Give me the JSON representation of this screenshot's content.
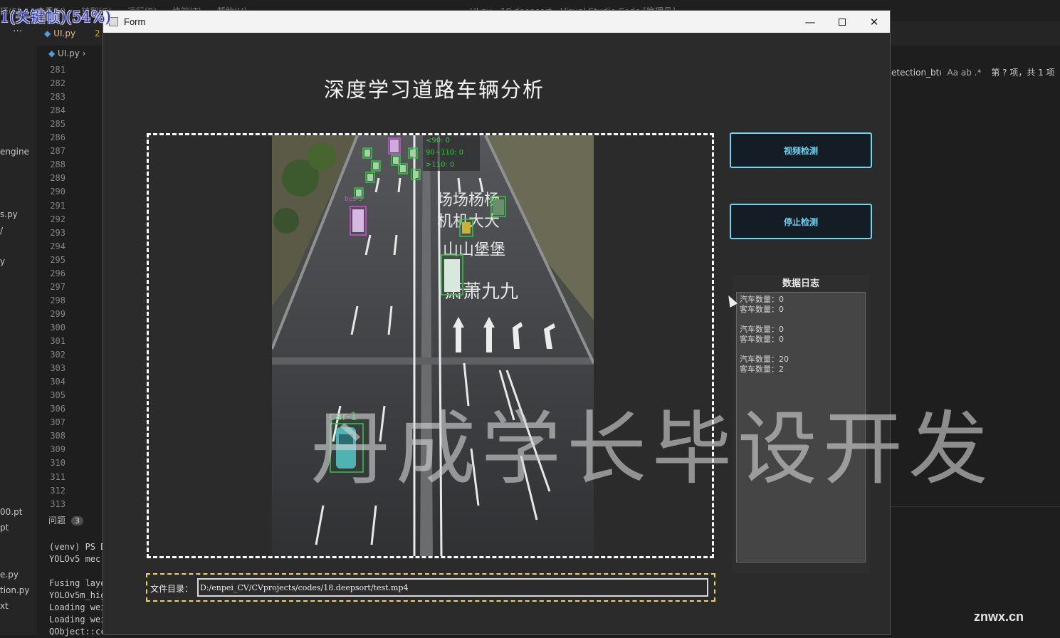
{
  "vscode": {
    "overlay_status": "1(关键帧)(54%)",
    "menus": [
      "择(S)",
      "查看(V)",
      "转到(G)",
      "运行(R)",
      "终端(T)",
      "帮助(H)"
    ],
    "window_title": "UI.py - 18.deepsort - Visual Studio Code [管理员]",
    "ellipsis": "···",
    "tab_file": "UI.py",
    "tab_num": "2",
    "breadcrumb": "UI.py",
    "explorer_items": [
      "engine",
      "s.py",
      "/",
      "y",
      "00.pt",
      "pt",
      "e.py",
      "tion.py",
      "xt"
    ],
    "line_numbers": [
      "281",
      "282",
      "283",
      "284",
      "285",
      "286",
      "287",
      "288",
      "289",
      "290",
      "291",
      "292",
      "293",
      "294",
      "295",
      "296",
      "297",
      "298",
      "299",
      "300",
      "301",
      "302",
      "303",
      "304",
      "305",
      "306",
      "307",
      "308",
      "309",
      "310",
      "311",
      "312",
      "313"
    ],
    "panel_label": "问题",
    "panel_badge": "3",
    "terminal_lines": [
      "(venv) PS D",
      "YOLOv5  mec",
      "",
      "Fusing laye",
      "YOLOv5m_hig",
      "Loading wei",
      "Loading wei",
      "QObject::cc"
    ],
    "find_term": "etection_btı",
    "find_opts": "Aa  ab  .*",
    "find_result": "第 ? 项，共 1 项"
  },
  "form": {
    "window_title": "Form",
    "min_glyph": "—",
    "close_glyph": "✕",
    "app_title": "深度学习道路车辆分析",
    "btn_video": "视频检测",
    "btn_stop": "停止检测",
    "log_title": "数据日志",
    "log_text": "汽车数量：0\n客车数量：0\n\n汽车数量：0\n客车数量：0\n\n汽车数量：20\n客车数量：2",
    "file_label": "文件目录：",
    "file_path": "D:/enpei_CV/CVprojects/codes/18.deepsort/test.mp4",
    "video": {
      "speed_lines": [
        "<90: 0",
        "90~110: 0",
        ">110: 0"
      ],
      "road_text": [
        "场场杨杨",
        "机机大大",
        "山山堡堡",
        "萧萧九九"
      ],
      "labels": [
        "car-1",
        "bus-5"
      ]
    }
  },
  "watermark": "丹成学长毕设开发",
  "brand": "znwx.cn",
  "colors": {
    "button_accent": "#6fd3f2",
    "file_border": "#f1d44a",
    "car_box": "#2ecc40",
    "bus_box": "#d34fe0"
  }
}
